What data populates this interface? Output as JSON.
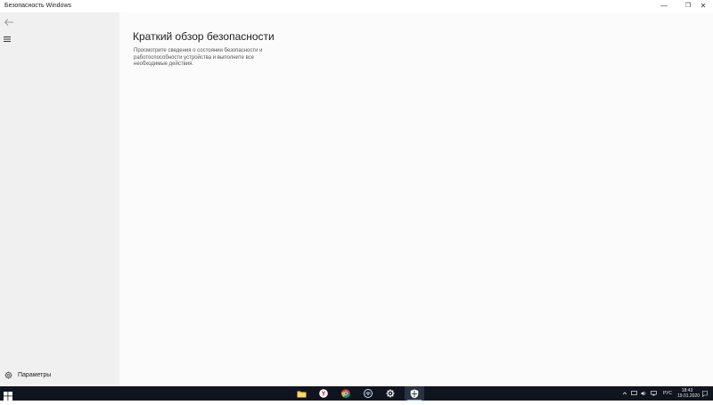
{
  "window": {
    "title": "Безопасность Windows",
    "controls": {
      "minimize": "—",
      "maximize": "❐",
      "close": "✕"
    }
  },
  "sidebar": {
    "back_icon": "back-arrow-icon",
    "menu_icon": "hamburger-icon",
    "settings_label": "Параметры",
    "settings_icon": "gear-icon"
  },
  "main": {
    "title": "Краткий обзор безопасности",
    "description": "Просмотрите сведения о состоянии безопасности и работоспособности устройства и выполните все необходимые действия."
  },
  "taskbar": {
    "apps": [
      {
        "name": "file-explorer",
        "icon": "folder-icon"
      },
      {
        "name": "yandex-browser",
        "icon": "yandex-icon"
      },
      {
        "name": "chrome",
        "icon": "chrome-icon"
      },
      {
        "name": "app",
        "icon": "app-icon"
      },
      {
        "name": "settings",
        "icon": "gear-icon"
      },
      {
        "name": "windows-security",
        "icon": "shield-icon",
        "active": true
      }
    ],
    "tray": {
      "language": "РУС",
      "time": "18:43",
      "date": "19.01.2020"
    }
  },
  "colors": {
    "accent": "#0078d7",
    "taskbar": "#10141f",
    "sidebar": "#f0f0f0",
    "content": "#fbfbfb"
  }
}
